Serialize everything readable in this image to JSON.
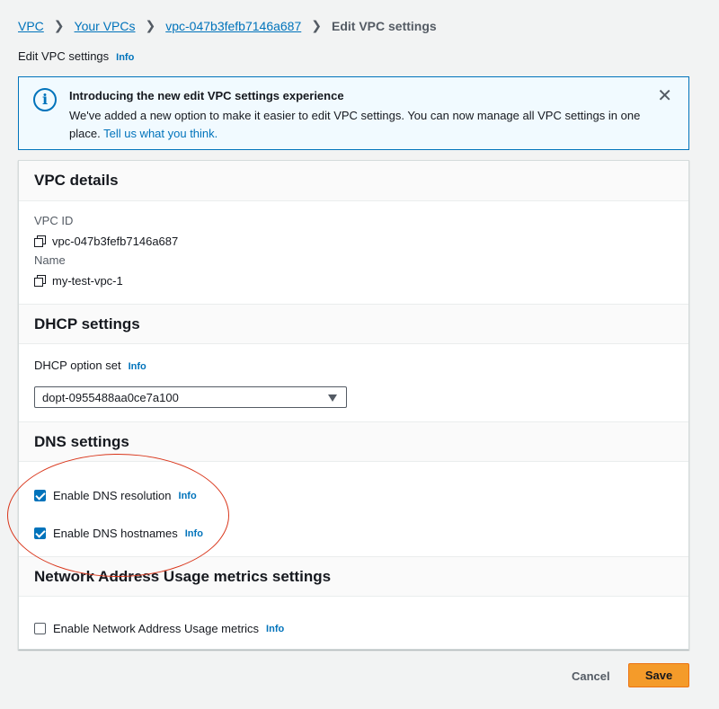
{
  "breadcrumb": {
    "items": [
      "VPC",
      "Your VPCs",
      "vpc-047b3fefb7146a687"
    ],
    "current": "Edit VPC settings"
  },
  "page": {
    "title": "Edit VPC settings",
    "info": "Info"
  },
  "flash": {
    "title": "Introducing the new edit VPC settings experience",
    "body": "We've added a new option to make it easier to edit VPC settings. You can now manage all VPC settings in one place.",
    "link": "Tell us what you think.",
    "icon": "info-icon"
  },
  "vpc_details": {
    "heading": "VPC details",
    "id_label": "VPC ID",
    "id_value": "vpc-047b3fefb7146a687",
    "name_label": "Name",
    "name_value": "my-test-vpc-1"
  },
  "dhcp": {
    "heading": "DHCP settings",
    "option_label": "DHCP option set",
    "info": "Info",
    "selected": "dopt-0955488aa0ce7a100"
  },
  "dns": {
    "heading": "DNS settings",
    "resolution_label": "Enable DNS resolution",
    "resolution_checked": true,
    "hostnames_label": "Enable DNS hostnames",
    "hostnames_checked": true,
    "info": "Info"
  },
  "nau": {
    "heading": "Network Address Usage metrics settings",
    "label": "Enable Network Address Usage metrics",
    "checked": false,
    "info": "Info"
  },
  "actions": {
    "cancel": "Cancel",
    "save": "Save"
  },
  "colors": {
    "link": "#0073bb",
    "primary": "#f49b2a",
    "annotation": "#d9361b"
  }
}
